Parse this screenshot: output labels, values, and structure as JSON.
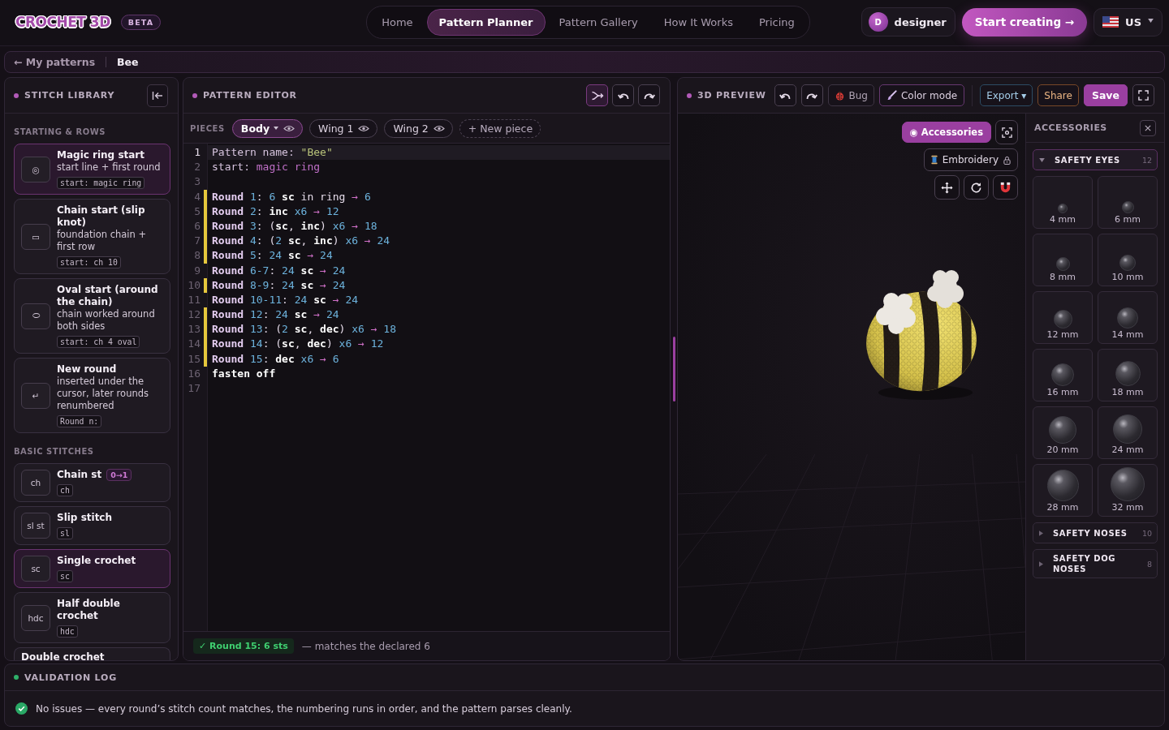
{
  "header": {
    "logo": "CROCHET 3D",
    "badge": "BETA",
    "nav": [
      {
        "label": "Home",
        "selected": false
      },
      {
        "label": "Pattern Planner",
        "selected": true
      },
      {
        "label": "Pattern Gallery",
        "selected": false
      },
      {
        "label": "How It Works",
        "selected": false
      },
      {
        "label": "Pricing",
        "selected": false
      }
    ],
    "user": {
      "initial": "D",
      "name": "designer"
    },
    "cta": "Start creating →",
    "locale": "US"
  },
  "breadcrumb": {
    "back": "← My patterns",
    "current": "Bee"
  },
  "library": {
    "title": "STITCH LIBRARY",
    "sections": [
      {
        "heading": "STARTING & ROWS",
        "items": [
          {
            "symbol": "◎",
            "title": "Magic ring start",
            "desc": "start line + first round",
            "code": "start: magic ring",
            "selected": true
          },
          {
            "symbol": "▭",
            "title": "Chain start (slip knot)",
            "desc": "foundation chain + first row",
            "code": "start: ch 10",
            "selected": false
          },
          {
            "symbol": "⬭",
            "title": "Oval start (around the chain)",
            "desc": "chain worked around both sides",
            "code": "start: ch 4 oval",
            "selected": false
          },
          {
            "symbol": "↵",
            "title": "New round",
            "desc": "inserted under the cursor, later rounds renumbered",
            "code": "Round n:",
            "selected": false
          }
        ]
      },
      {
        "heading": "BASIC STITCHES",
        "items": [
          {
            "symbol": "ch",
            "title": "Chain st",
            "badge": "0→1",
            "code": "ch",
            "selected": false
          },
          {
            "symbol": "sl st",
            "title": "Slip stitch",
            "code": "sl",
            "selected": false
          },
          {
            "symbol": "sc",
            "title": "Single crochet",
            "code": "sc",
            "selected": true
          },
          {
            "symbol": "hdc",
            "title": "Half double crochet",
            "code": "hdc",
            "selected": false
          },
          {
            "title": "Double crochet",
            "selected": false
          }
        ]
      }
    ]
  },
  "editor": {
    "title": "PATTERN EDITOR",
    "tools": [
      {
        "kind": "merge",
        "selected": true
      },
      {
        "kind": "undo",
        "selected": false
      },
      {
        "kind": "redo",
        "selected": false
      }
    ],
    "pieces": {
      "label": "PIECES",
      "items": [
        {
          "name": "Body",
          "selected": true,
          "visible": true
        },
        {
          "name": "Wing 1",
          "selected": false,
          "visible": true
        },
        {
          "name": "Wing 2",
          "selected": false,
          "visible": true
        }
      ],
      "add": "+ New piece"
    },
    "lines": [
      {
        "number": "1",
        "marked": false,
        "current": true,
        "tokens": [
          {
            "kind": "key",
            "text": "Pattern name: "
          },
          {
            "kind": "str",
            "text": "\"Bee\""
          }
        ]
      },
      {
        "number": "2",
        "marked": false,
        "current": false,
        "tokens": [
          {
            "kind": "key",
            "text": "start: "
          },
          {
            "kind": "val",
            "text": "magic ring"
          }
        ]
      },
      {
        "number": "3",
        "marked": false,
        "current": false
      },
      {
        "number": "4",
        "marked": true,
        "current": false,
        "tokens": [
          {
            "kind": "kw",
            "text": "Round "
          },
          {
            "kind": "num",
            "text": "1"
          },
          {
            "kind": "txt",
            "text": ": "
          },
          {
            "kind": "num",
            "text": "6 "
          },
          {
            "kind": "st",
            "text": "sc"
          },
          {
            "kind": "txt",
            "text": " in ring"
          },
          {
            "kind": "arrow",
            "text": " → "
          },
          {
            "kind": "num",
            "text": "6"
          }
        ]
      },
      {
        "number": "5",
        "marked": true,
        "current": false,
        "tokens": [
          {
            "kind": "kw",
            "text": "Round "
          },
          {
            "kind": "num",
            "text": "2"
          },
          {
            "kind": "txt",
            "text": ": "
          },
          {
            "kind": "st",
            "text": "inc"
          },
          {
            "kind": "num",
            "text": " x6"
          },
          {
            "kind": "arrow",
            "text": " → "
          },
          {
            "kind": "num",
            "text": "12"
          }
        ]
      },
      {
        "number": "6",
        "marked": true,
        "current": false,
        "tokens": [
          {
            "kind": "kw",
            "text": "Round "
          },
          {
            "kind": "num",
            "text": "3"
          },
          {
            "kind": "txt",
            "text": ": ("
          },
          {
            "kind": "st",
            "text": "sc"
          },
          {
            "kind": "txt",
            "text": ", "
          },
          {
            "kind": "st",
            "text": "inc"
          },
          {
            "kind": "txt",
            "text": ")"
          },
          {
            "kind": "num",
            "text": " x6"
          },
          {
            "kind": "arrow",
            "text": " → "
          },
          {
            "kind": "num",
            "text": "18"
          }
        ]
      },
      {
        "number": "7",
        "marked": true,
        "current": false,
        "tokens": [
          {
            "kind": "kw",
            "text": "Round "
          },
          {
            "kind": "num",
            "text": "4"
          },
          {
            "kind": "txt",
            "text": ": ("
          },
          {
            "kind": "num",
            "text": "2 "
          },
          {
            "kind": "st",
            "text": "sc"
          },
          {
            "kind": "txt",
            "text": ", "
          },
          {
            "kind": "st",
            "text": "inc"
          },
          {
            "kind": "txt",
            "text": ")"
          },
          {
            "kind": "num",
            "text": " x6"
          },
          {
            "kind": "arrow",
            "text": " → "
          },
          {
            "kind": "num",
            "text": "24"
          }
        ]
      },
      {
        "number": "8",
        "marked": true,
        "current": false,
        "tokens": [
          {
            "kind": "kw",
            "text": "Round "
          },
          {
            "kind": "num",
            "text": "5"
          },
          {
            "kind": "txt",
            "text": ": "
          },
          {
            "kind": "num",
            "text": "24 "
          },
          {
            "kind": "st",
            "text": "sc"
          },
          {
            "kind": "arrow",
            "text": " → "
          },
          {
            "kind": "num",
            "text": "24"
          }
        ]
      },
      {
        "number": "9",
        "marked": false,
        "current": false,
        "tokens": [
          {
            "kind": "kw",
            "text": "Round "
          },
          {
            "kind": "num",
            "text": "6-7"
          },
          {
            "kind": "txt",
            "text": ": "
          },
          {
            "kind": "num",
            "text": "24 "
          },
          {
            "kind": "st",
            "text": "sc"
          },
          {
            "kind": "arrow",
            "text": " → "
          },
          {
            "kind": "num",
            "text": "24"
          }
        ]
      },
      {
        "number": "10",
        "marked": true,
        "current": false,
        "tokens": [
          {
            "kind": "kw",
            "text": "Round "
          },
          {
            "kind": "num",
            "text": "8-9"
          },
          {
            "kind": "txt",
            "text": ": "
          },
          {
            "kind": "num",
            "text": "24 "
          },
          {
            "kind": "st",
            "text": "sc"
          },
          {
            "kind": "arrow",
            "text": " → "
          },
          {
            "kind": "num",
            "text": "24"
          }
        ]
      },
      {
        "number": "11",
        "marked": false,
        "current": false,
        "tokens": [
          {
            "kind": "kw",
            "text": "Round "
          },
          {
            "kind": "num",
            "text": "10-11"
          },
          {
            "kind": "txt",
            "text": ": "
          },
          {
            "kind": "num",
            "text": "24 "
          },
          {
            "kind": "st",
            "text": "sc"
          },
          {
            "kind": "arrow",
            "text": " → "
          },
          {
            "kind": "num",
            "text": "24"
          }
        ]
      },
      {
        "number": "12",
        "marked": true,
        "current": false,
        "tokens": [
          {
            "kind": "kw",
            "text": "Round "
          },
          {
            "kind": "num",
            "text": "12"
          },
          {
            "kind": "txt",
            "text": ": "
          },
          {
            "kind": "num",
            "text": "24 "
          },
          {
            "kind": "st",
            "text": "sc"
          },
          {
            "kind": "arrow",
            "text": " → "
          },
          {
            "kind": "num",
            "text": "24"
          }
        ]
      },
      {
        "number": "13",
        "marked": true,
        "current": false,
        "tokens": [
          {
            "kind": "kw",
            "text": "Round "
          },
          {
            "kind": "num",
            "text": "13"
          },
          {
            "kind": "txt",
            "text": ": ("
          },
          {
            "kind": "num",
            "text": "2 "
          },
          {
            "kind": "st",
            "text": "sc"
          },
          {
            "kind": "txt",
            "text": ", "
          },
          {
            "kind": "st",
            "text": "dec"
          },
          {
            "kind": "txt",
            "text": ")"
          },
          {
            "kind": "num",
            "text": " x6"
          },
          {
            "kind": "arrow",
            "text": " → "
          },
          {
            "kind": "num",
            "text": "18"
          }
        ]
      },
      {
        "number": "14",
        "marked": true,
        "current": false,
        "tokens": [
          {
            "kind": "kw",
            "text": "Round "
          },
          {
            "kind": "num",
            "text": "14"
          },
          {
            "kind": "txt",
            "text": ": ("
          },
          {
            "kind": "st",
            "text": "sc"
          },
          {
            "kind": "txt",
            "text": ", "
          },
          {
            "kind": "st",
            "text": "dec"
          },
          {
            "kind": "txt",
            "text": ")"
          },
          {
            "kind": "num",
            "text": " x6"
          },
          {
            "kind": "arrow",
            "text": " → "
          },
          {
            "kind": "num",
            "text": "12"
          }
        ]
      },
      {
        "number": "15",
        "marked": true,
        "current": false,
        "tokens": [
          {
            "kind": "kw",
            "text": "Round "
          },
          {
            "kind": "num",
            "text": "15"
          },
          {
            "kind": "txt",
            "text": ": "
          },
          {
            "kind": "st",
            "text": "dec"
          },
          {
            "kind": "num",
            "text": " x6"
          },
          {
            "kind": "arrow",
            "text": " → "
          },
          {
            "kind": "num",
            "text": "6"
          }
        ]
      },
      {
        "number": "16",
        "marked": false,
        "current": false,
        "tokens": [
          {
            "kind": "st",
            "text": "fasten off"
          }
        ]
      },
      {
        "number": "17",
        "marked": false,
        "current": false
      }
    ],
    "status": {
      "badge": "✓ Round 15: 6 sts",
      "note": "— matches the declared 6"
    }
  },
  "preview": {
    "title": "3D PREVIEW",
    "actions": [
      {
        "kind": "bug",
        "label": "Bug"
      },
      {
        "kind": "brush",
        "label": "Color mode"
      },
      {
        "kind": "export",
        "label": "Export ▾"
      },
      {
        "kind": "share",
        "label": "Share"
      },
      {
        "kind": "save",
        "label": "Save"
      }
    ],
    "accessories_toggle": {
      "label": "◉ Accessories",
      "selected": true
    },
    "embroidery": {
      "label": "Embroidery",
      "locked": true
    }
  },
  "accessories": {
    "title": "ACCESSORIES",
    "groups": [
      {
        "name": "SAFETY EYES",
        "count": "12",
        "expanded": true,
        "items": [
          "4 mm",
          "6 mm",
          "8 mm",
          "10 mm",
          "12 mm",
          "14 mm",
          "16 mm",
          "18 mm",
          "20 mm",
          "24 mm",
          "28 mm",
          "32 mm"
        ]
      },
      {
        "name": "SAFETY NOSES",
        "count": "10",
        "expanded": false
      },
      {
        "name": "SAFETY DOG NOSES",
        "count": "8",
        "expanded": false
      }
    ]
  },
  "validation_log": {
    "title": "VALIDATION LOG",
    "passed": true,
    "message": "No issues — every round’s stitch count matches, the numbering runs in order, and the pattern parses cleanly."
  }
}
